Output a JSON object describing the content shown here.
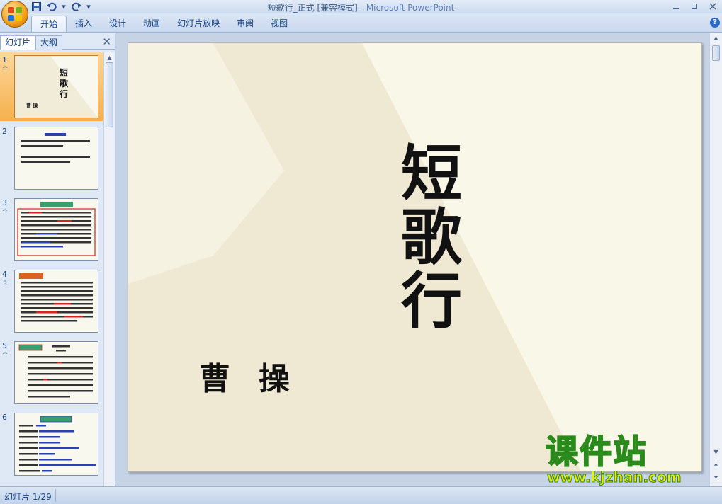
{
  "window": {
    "title_doc": "短歌行_正式 [兼容模式]",
    "title_sep": " - ",
    "title_app": "Microsoft PowerPoint"
  },
  "qat": [
    {
      "name": "save-icon",
      "glyph": "💾"
    },
    {
      "name": "undo-icon",
      "glyph": "↶"
    },
    {
      "name": "dropdown-icon",
      "glyph": "▾"
    },
    {
      "name": "redo-icon",
      "glyph": "↻"
    },
    {
      "name": "customize-icon",
      "glyph": "▾"
    }
  ],
  "ribbon": {
    "tabs": [
      "开始",
      "插入",
      "设计",
      "动画",
      "幻灯片放映",
      "审阅",
      "视图"
    ],
    "active_tab": "开始"
  },
  "pane": {
    "slides_tab": "幻灯片",
    "outline_tab": "大纲",
    "thumbnails": [
      {
        "number": "1",
        "anim": "☆",
        "selected": true
      },
      {
        "number": "2",
        "anim": "",
        "selected": false
      },
      {
        "number": "3",
        "anim": "☆",
        "selected": false
      },
      {
        "number": "4",
        "anim": "☆",
        "selected": false
      },
      {
        "number": "5",
        "anim": "☆",
        "selected": false
      },
      {
        "number": "6",
        "anim": "",
        "selected": false
      }
    ]
  },
  "slide": {
    "title": "短歌行",
    "author": "曹操"
  },
  "watermark": {
    "big": "课件站",
    "url": "www.kjzhan.com"
  },
  "status": {
    "slide_counter": "幻灯片 1/29"
  },
  "colors": {
    "accent_selected": "#f5b04c",
    "slide_bg": "#f9f7e8",
    "watermark_fill": "#f3e600",
    "watermark_stroke": "#2a8a1c"
  }
}
